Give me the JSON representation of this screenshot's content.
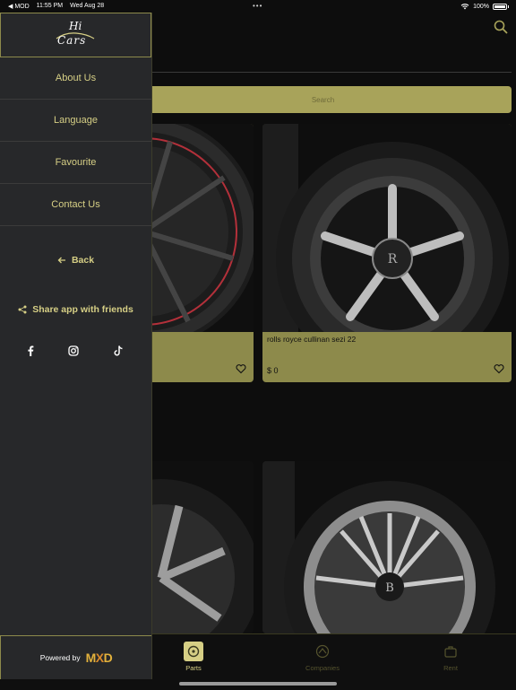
{
  "status_bar": {
    "carrier": "◀ MOD",
    "time": "11:55 PM",
    "date": "Wed Aug 28",
    "dots": "•••",
    "battery": "100%"
  },
  "drawer": {
    "logo": {
      "line1": "Hi",
      "line2": "Cars"
    },
    "menu": [
      {
        "label": "About Us"
      },
      {
        "label": "Language"
      },
      {
        "label": "Favourite"
      },
      {
        "label": "Contact Us"
      }
    ],
    "back_label": "Back",
    "share_label": "Share app with friends",
    "social_icons": [
      "facebook-icon",
      "instagram-icon",
      "tiktok-icon"
    ],
    "powered_by": "Powered by",
    "powered_brand": {
      "m": "M",
      "x": "X",
      "d": "D"
    }
  },
  "main": {
    "search_placeholder": "Search",
    "products": [
      {
        "name": "",
        "price": ""
      },
      {
        "name": "rolls royce cullinan sezi 22",
        "price": "$ 0"
      }
    ]
  },
  "tabbar": {
    "tabs": [
      {
        "label": "Parts",
        "active": true
      },
      {
        "label": "Companies",
        "active": false
      },
      {
        "label": "Rent",
        "active": false
      }
    ]
  },
  "colors": {
    "accent": "#d6cf85",
    "card": "#8d8a4b",
    "search": "#a8a35a",
    "drawer_bg": "#27282a"
  }
}
